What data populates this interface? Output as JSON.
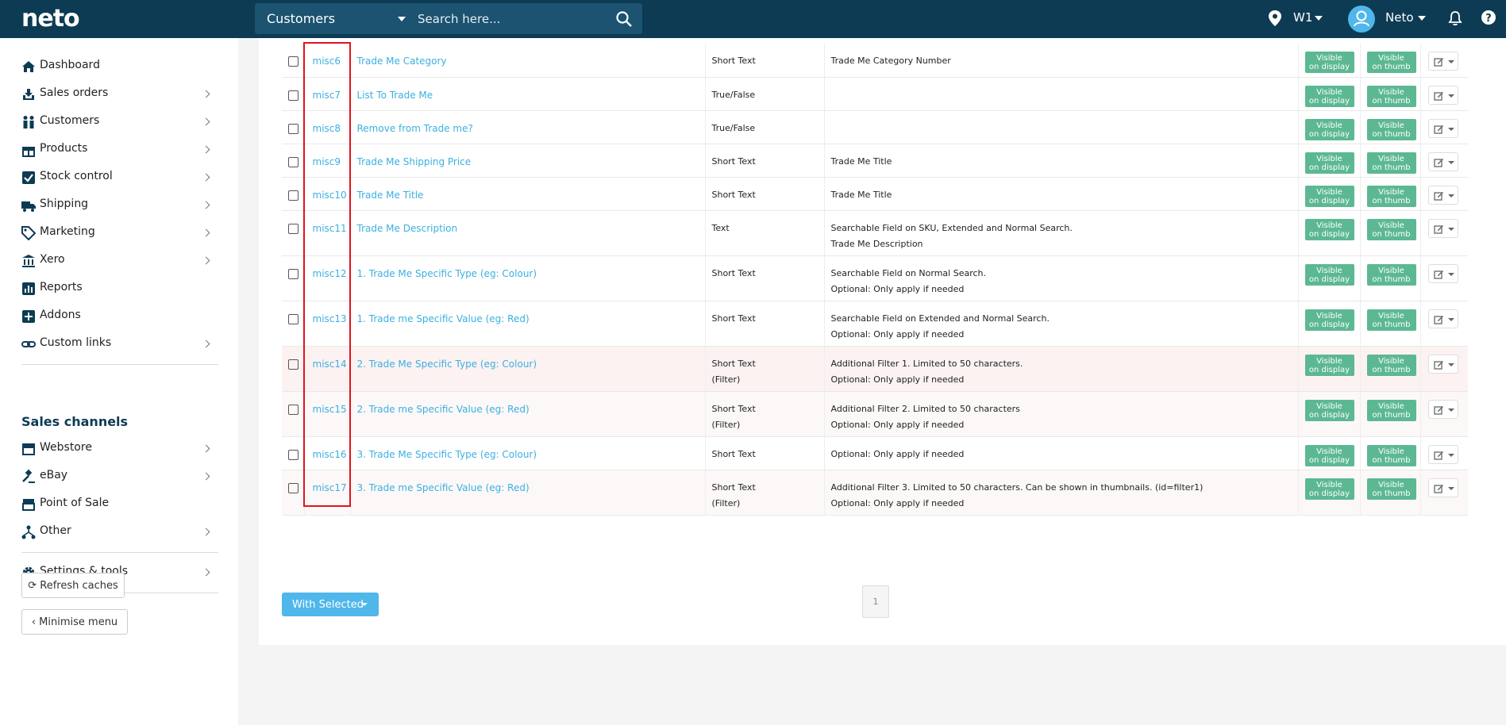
{
  "topbar": {
    "logo": "neto",
    "search_scope": "Customers",
    "search_placeholder": "Search here...",
    "location": "W1",
    "user": "Neto"
  },
  "sidebar": {
    "items": [
      {
        "label": "Dashboard",
        "icon": "home-icon"
      },
      {
        "label": "Sales orders",
        "icon": "download-icon"
      },
      {
        "label": "Customers",
        "icon": "people-icon"
      },
      {
        "label": "Products",
        "icon": "gift-icon"
      },
      {
        "label": "Stock control",
        "icon": "checkbox-icon"
      },
      {
        "label": "Shipping",
        "icon": "truck-icon"
      },
      {
        "label": "Marketing",
        "icon": "tag-icon"
      },
      {
        "label": "Xero",
        "icon": "bank-icon"
      },
      {
        "label": "Reports",
        "icon": "chart-icon"
      },
      {
        "label": "Addons",
        "icon": "plus-square-icon"
      },
      {
        "label": "Custom links",
        "icon": "link-icon"
      }
    ],
    "channels_title": "Sales channels",
    "channels": [
      {
        "label": "Webstore",
        "icon": "store-icon"
      },
      {
        "label": "eBay",
        "icon": "gavel-icon"
      },
      {
        "label": "Point of Sale",
        "icon": "register-icon"
      },
      {
        "label": "Other",
        "icon": "sitemap-icon"
      }
    ],
    "settings": "Settings & tools",
    "refresh": "Refresh caches",
    "minimise": "Minimise menu"
  },
  "table": {
    "badge_display_1": "Visible",
    "badge_display_2": "on display",
    "badge_thumb_1": "Visible",
    "badge_thumb_2": "on thumb",
    "rows": [
      {
        "id": "misc6",
        "name": "Trade Me Category",
        "type": [
          "Short Text"
        ],
        "desc": [
          "Trade Me Category Number"
        ]
      },
      {
        "id": "misc7",
        "name": "List To Trade Me",
        "type": [
          "True/False"
        ],
        "desc": []
      },
      {
        "id": "misc8",
        "name": "Remove from Trade me?",
        "type": [
          "True/False"
        ],
        "desc": []
      },
      {
        "id": "misc9",
        "name": "Trade Me Shipping Price",
        "type": [
          "Short Text"
        ],
        "desc": [
          "Trade Me Title"
        ]
      },
      {
        "id": "misc10",
        "name": "Trade Me Title",
        "type": [
          "Short Text"
        ],
        "desc": [
          "Trade Me Title"
        ]
      },
      {
        "id": "misc11",
        "name": "Trade Me Description",
        "type": [
          "Text"
        ],
        "desc": [
          "Searchable Field on SKU, Extended and Normal Search.",
          "Trade Me Description"
        ]
      },
      {
        "id": "misc12",
        "name": "1. Trade Me Specific Type (eg: Colour)",
        "type": [
          "Short Text"
        ],
        "desc": [
          "Searchable Field on Normal Search.",
          "Optional: Only apply if needed"
        ]
      },
      {
        "id": "misc13",
        "name": "1. Trade me Specific Value (eg: Red)",
        "type": [
          "Short Text"
        ],
        "desc": [
          "Searchable Field on Extended and Normal Search.",
          "Optional: Only apply if needed"
        ]
      },
      {
        "id": "misc14",
        "name": "2. Trade Me Specific Type (eg: Colour)",
        "type": [
          "Short Text",
          "(Filter)"
        ],
        "desc": [
          "Additional Filter 1. Limited to 50 characters.",
          "Optional: Only apply if needed"
        ]
      },
      {
        "id": "misc15",
        "name": "2. Trade me Specific Value (eg: Red)",
        "type": [
          "Short Text",
          "(Filter)"
        ],
        "desc": [
          "Additional Filter 2. Limited to 50 characters",
          "Optional: Only apply if needed"
        ]
      },
      {
        "id": "misc16",
        "name": "3. Trade Me Specific Type (eg: Colour)",
        "type": [
          "Short Text"
        ],
        "desc": [
          "Optional: Only apply if needed"
        ]
      },
      {
        "id": "misc17",
        "name": "3. Trade me Specific Value (eg: Red)",
        "type": [
          "Short Text",
          "(Filter)"
        ],
        "desc": [
          "Additional Filter 3. Limited to 50 characters. Can be shown in thumbnails. (id=filter1)",
          "Optional: Only apply if needed"
        ]
      }
    ]
  },
  "footer": {
    "with_selected": "With  Selected",
    "page": "1"
  },
  "colors": {
    "topbar": "#0d3b54",
    "link": "#3bb0e0",
    "badge": "#5cb893",
    "highlight": "#e0141e"
  }
}
